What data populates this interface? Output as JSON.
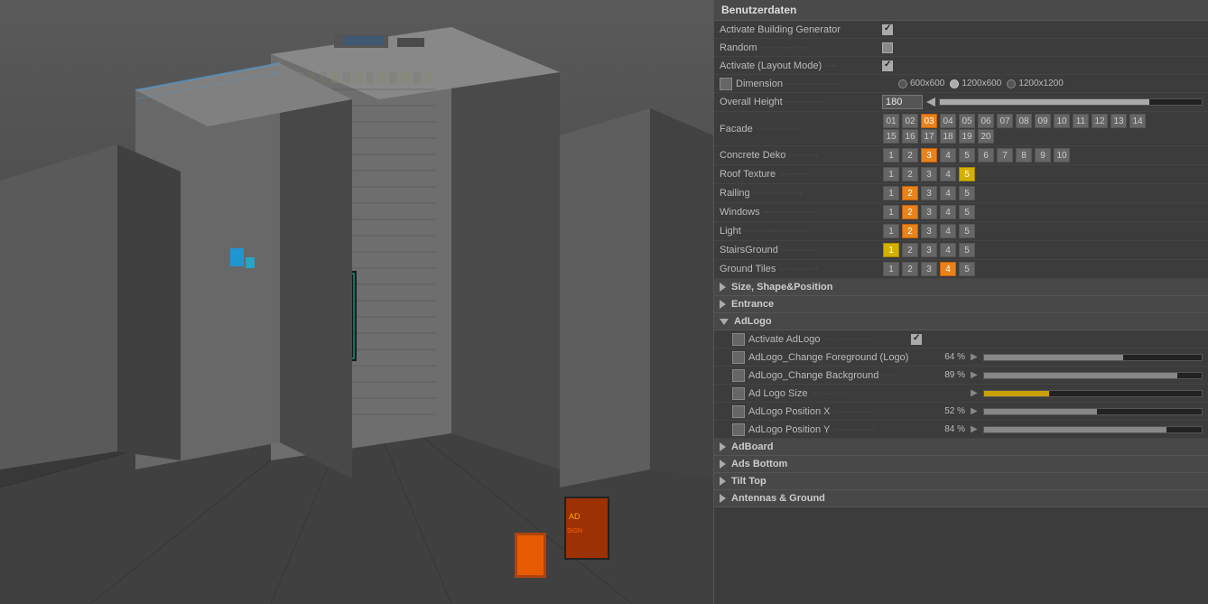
{
  "panel": {
    "header": "Benutzerdaten",
    "rows": {
      "activate_building_generator": "Activate Building Generator",
      "random": "Random",
      "activate_layout": "Activate (Layout Mode)",
      "dimension": "Dimension",
      "overall_height": "Overall Height",
      "facade": "Facade",
      "concrete_deko": "Concrete Deko",
      "roof_texture": "Roof Texture",
      "railing": "Railing",
      "windows": "Windows",
      "light": "Light",
      "stairs_ground": "StairsGround",
      "ground_tiles": "Ground Tiles"
    },
    "dimension_options": [
      "600x600",
      "1200x600",
      "1200x1200"
    ],
    "dimension_active": 1,
    "overall_height_value": "180",
    "facade_numbers": [
      "01",
      "02",
      "03",
      "04",
      "05",
      "06",
      "07",
      "08",
      "09",
      "10",
      "11",
      "12",
      "13",
      "14",
      "15",
      "16",
      "17",
      "18",
      "19",
      "20"
    ],
    "facade_active": "03",
    "concrete_deko_nums": [
      "1",
      "2",
      "3",
      "4",
      "5",
      "6",
      "7",
      "8",
      "9",
      "10"
    ],
    "concrete_deko_active": "3",
    "roof_texture_nums": [
      "1",
      "2",
      "3",
      "4",
      "5"
    ],
    "roof_texture_active": "5",
    "railing_nums": [
      "1",
      "2",
      "3",
      "4",
      "5"
    ],
    "railing_active": "2",
    "windows_nums": [
      "1",
      "2",
      "3",
      "4",
      "5"
    ],
    "windows_active": "2",
    "light_nums": [
      "1",
      "2",
      "3",
      "4",
      "5"
    ],
    "light_active": "2",
    "stairs_ground_nums": [
      "1",
      "2",
      "3",
      "4",
      "5"
    ],
    "stairs_ground_active": "1",
    "ground_tiles_nums": [
      "1",
      "2",
      "3",
      "4",
      "5"
    ],
    "ground_tiles_active": "4",
    "sections": {
      "size_shape": "Size, Shape&Position",
      "entrance": "Entrance",
      "adlogo": "AdLogo",
      "adboard": "AdBoard",
      "ads_bottom": "Ads Bottom",
      "tilt_top": "Tilt Top",
      "antennas_ground": "Antennas & Ground"
    },
    "adlogo_rows": {
      "activate": "Activate AdLogo",
      "foreground": "AdLogo_Change Foreground (Logo)",
      "background": "AdLogo_Change Background",
      "size": "Ad Logo Size",
      "position_x": "AdLogo Position X",
      "position_y": "AdLogo Position Y"
    },
    "adlogo_values": {
      "foreground_pct": "64 %",
      "foreground_fill": 64,
      "background_pct": "89 %",
      "background_fill": 89,
      "size_pct": "",
      "size_fill": 30,
      "position_x_pct": "52 %",
      "position_x_fill": 52,
      "position_y_pct": "84 %",
      "position_y_fill": 84
    }
  }
}
